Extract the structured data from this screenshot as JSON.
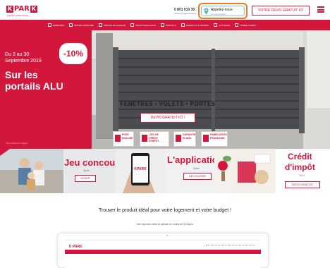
{
  "header": {
    "logo_text": "PAR",
    "logo_tagline": "Fenêtres Volets Portes",
    "phone": "0 801 010 30",
    "phone_sub": "service & appel gratuits",
    "callback_label": "Appelez-nous",
    "callback_sub": "ou rappel gratuit",
    "quote_button": "VOTRE DEVIS GRATUIT ICI"
  },
  "nav": {
    "items": [
      {
        "label": "FENÊTRES",
        "icon": "window-icon"
      },
      {
        "label": "PORTES D'ENTRÉE",
        "icon": "door-icon"
      },
      {
        "label": "PORTES DE GARAGE",
        "icon": "garage-icon"
      },
      {
        "label": "VOLETS ROULANTS",
        "icon": "shutter-icon"
      },
      {
        "label": "PORTAILS",
        "icon": "gate-icon"
      },
      {
        "label": "PERGOLAS & STORES",
        "icon": "pergola-icon"
      },
      {
        "label": "CLÔTURES",
        "icon": "fence-icon"
      },
      {
        "label": "GARDE-CORPS",
        "icon": "railing-icon"
      }
    ]
  },
  "hero": {
    "date_line1": "Du 3 au 30",
    "date_line2": "Septembre 2019",
    "promo": "-10%",
    "promo_suffix": "*",
    "headline": "Sur les portails ALU",
    "products": "FENÊTRES • VOLETS • PORTES",
    "cta": "DEVIS GRATUIT ICI !",
    "legal": "*Voir conditions en magasin",
    "badges": [
      "POSE INCLUSE",
      "-15% DE CRÉDIT D'IMPÔT",
      "GARANTIE 30 ANS",
      "FABRICATION FRANÇAISE"
    ]
  },
  "promos": {
    "contest": {
      "title": "Jeu concours",
      "sub": "Kpark",
      "button": "JOUER"
    },
    "app": {
      "title": "L'application",
      "sub": "Kpark",
      "button": "DÉCOUVRIR"
    },
    "tax": {
      "title_line1": "Crédit",
      "title_line2": "d'impôt",
      "sub": "2019",
      "button": "DEVIS GRATUIT"
    }
  },
  "finder": {
    "title": "Trouver le produit idéal pour votre logement et votre budget !",
    "subtitle": "Une réponse claire et précise en moins de 3 étapes.",
    "mock_logo": "K PARK"
  },
  "colors": {
    "brand_red": "#d3163b",
    "callback_highlight": "#f07a18"
  }
}
